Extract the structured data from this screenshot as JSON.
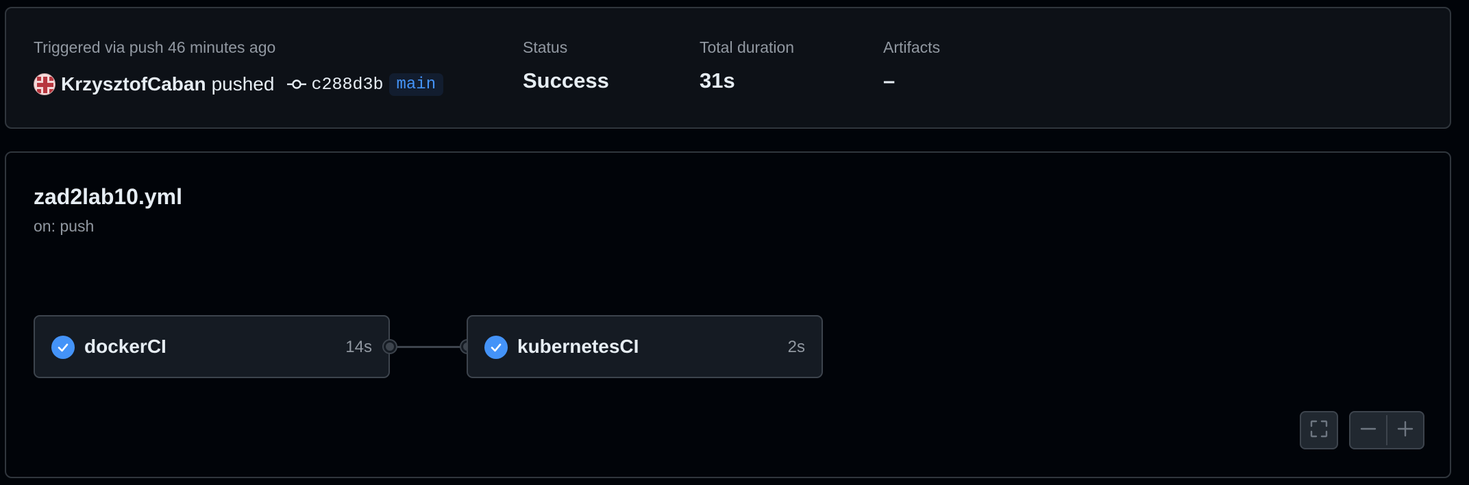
{
  "summary": {
    "trigger_text": "Triggered via push 46 minutes ago",
    "actor": "KrzysztofCaban",
    "action": "pushed",
    "commit_sha": "c288d3b",
    "branch": "main",
    "status_label": "Status",
    "status_value": "Success",
    "duration_label": "Total duration",
    "duration_value": "31s",
    "artifacts_label": "Artifacts",
    "artifacts_value": "–"
  },
  "workflow": {
    "file": "zad2lab10.yml",
    "trigger": "on: push",
    "jobs": [
      {
        "name": "dockerCI",
        "duration": "14s",
        "status": "success"
      },
      {
        "name": "kubernetesCI",
        "duration": "2s",
        "status": "success"
      }
    ]
  },
  "icons": {
    "avatar": "avatar-identicon",
    "commit": "git-commit-icon",
    "job_status": "check-circle-icon",
    "fullscreen": "fullscreen-icon",
    "zoom_out": "minus-icon",
    "zoom_in": "plus-icon"
  },
  "colors": {
    "accent": "#4493f8",
    "background": "#010409",
    "panel": "#0d1117",
    "border": "#30363d",
    "job_background": "#151b23",
    "muted_text": "#9198a1",
    "text": "#e6edf3"
  }
}
